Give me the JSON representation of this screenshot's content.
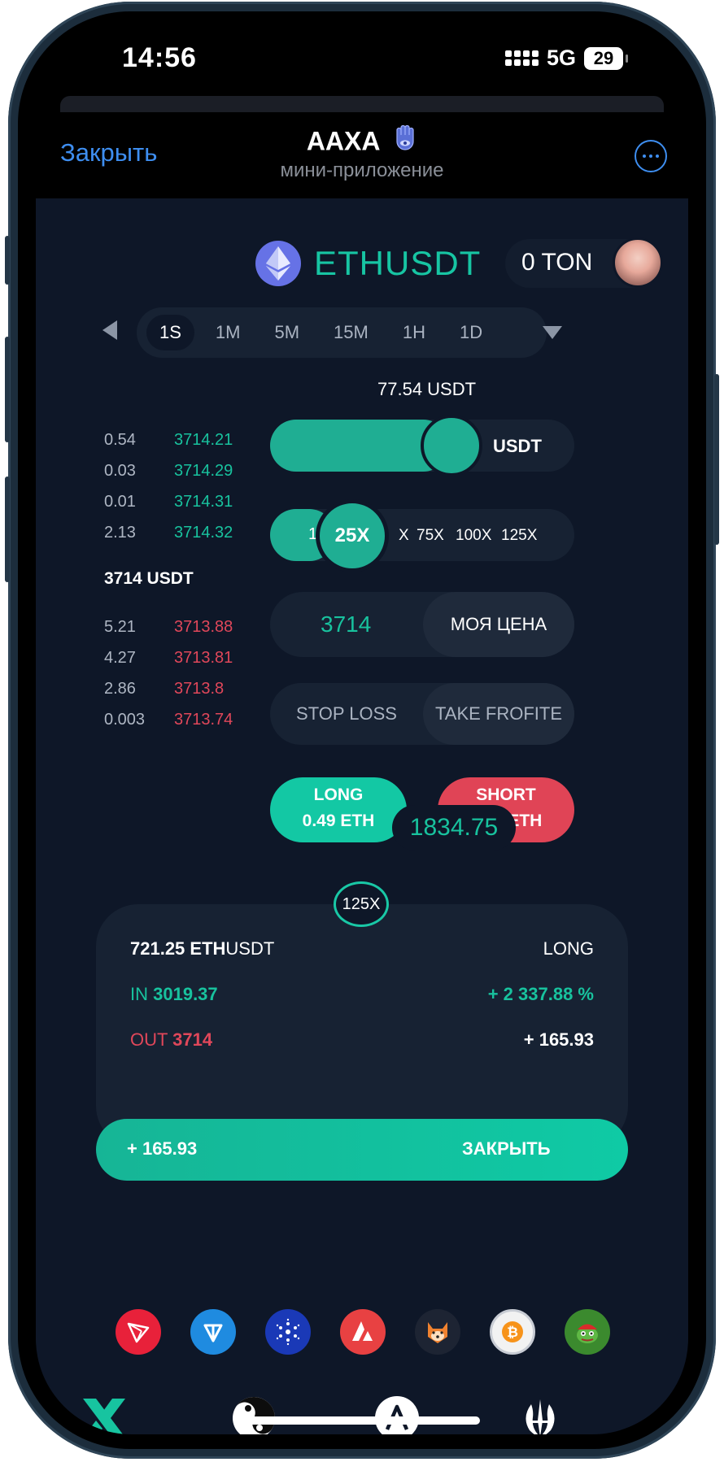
{
  "status_bar": {
    "time": "14:56",
    "network": "5G",
    "battery": "29"
  },
  "header": {
    "close_label": "Закрыть",
    "title": "AAXA",
    "subtitle": "мини-приложение"
  },
  "market": {
    "pair": "ETHUSDT",
    "balance": "0 TON"
  },
  "timeframes": {
    "items": [
      "1S",
      "1M",
      "5M",
      "15M",
      "1H",
      "1D"
    ],
    "selected": "1S"
  },
  "order_book": {
    "buys": [
      {
        "qty": "0.54",
        "price": "3714.21"
      },
      {
        "qty": "0.03",
        "price": "3714.29"
      },
      {
        "qty": "0.01",
        "price": "3714.31"
      },
      {
        "qty": "2.13",
        "price": "3714.32"
      }
    ],
    "mid": "3714 USDT",
    "sells": [
      {
        "qty": "5.21",
        "price": "3713.88"
      },
      {
        "qty": "4.27",
        "price": "3713.81"
      },
      {
        "qty": "2.86",
        "price": "3713.8"
      },
      {
        "qty": "0.003",
        "price": "3713.74"
      }
    ]
  },
  "amount": {
    "label": "77.54 USDT",
    "unit": "USDT",
    "fill_fraction": 0.52
  },
  "leverage": {
    "start": "1",
    "selected": "25X",
    "options": [
      "X",
      "75X",
      "100X",
      "125X"
    ]
  },
  "price": {
    "value": "3714",
    "my_price_label": "МОЯ ЦЕНА"
  },
  "risk": {
    "stop_loss": "STOP LOSS",
    "take_profit": "TAKE FROFITE"
  },
  "actions": {
    "long_label": "LONG",
    "long_amount": "0.49 ETH",
    "short_label": "SHORT",
    "short_amount": "0.49 ETH",
    "mid_price": "1834.75"
  },
  "position": {
    "leverage": "125X",
    "size_bold": "721.25 ETH",
    "size_rest": "USDT",
    "side": "LONG",
    "in_label": "IN",
    "in_value": "3019.37",
    "pct_change": "+ 2 337.88 %",
    "out_label": "OUT",
    "out_value": "3714",
    "pnl": "+ 165.93",
    "close_pnl": "+ 165.93",
    "close_label": "ЗАКРЫТЬ"
  },
  "coin_icons": [
    "tron-icon",
    "ton-icon",
    "cardano-icon",
    "avalanche-icon",
    "shiba-icon",
    "bitcoin-icon",
    "pepe-icon"
  ],
  "colors": {
    "accent": "#18c29e",
    "danger": "#e0475a",
    "background": "#0e1728",
    "panel": "#172233",
    "link": "#3e8ef0"
  }
}
